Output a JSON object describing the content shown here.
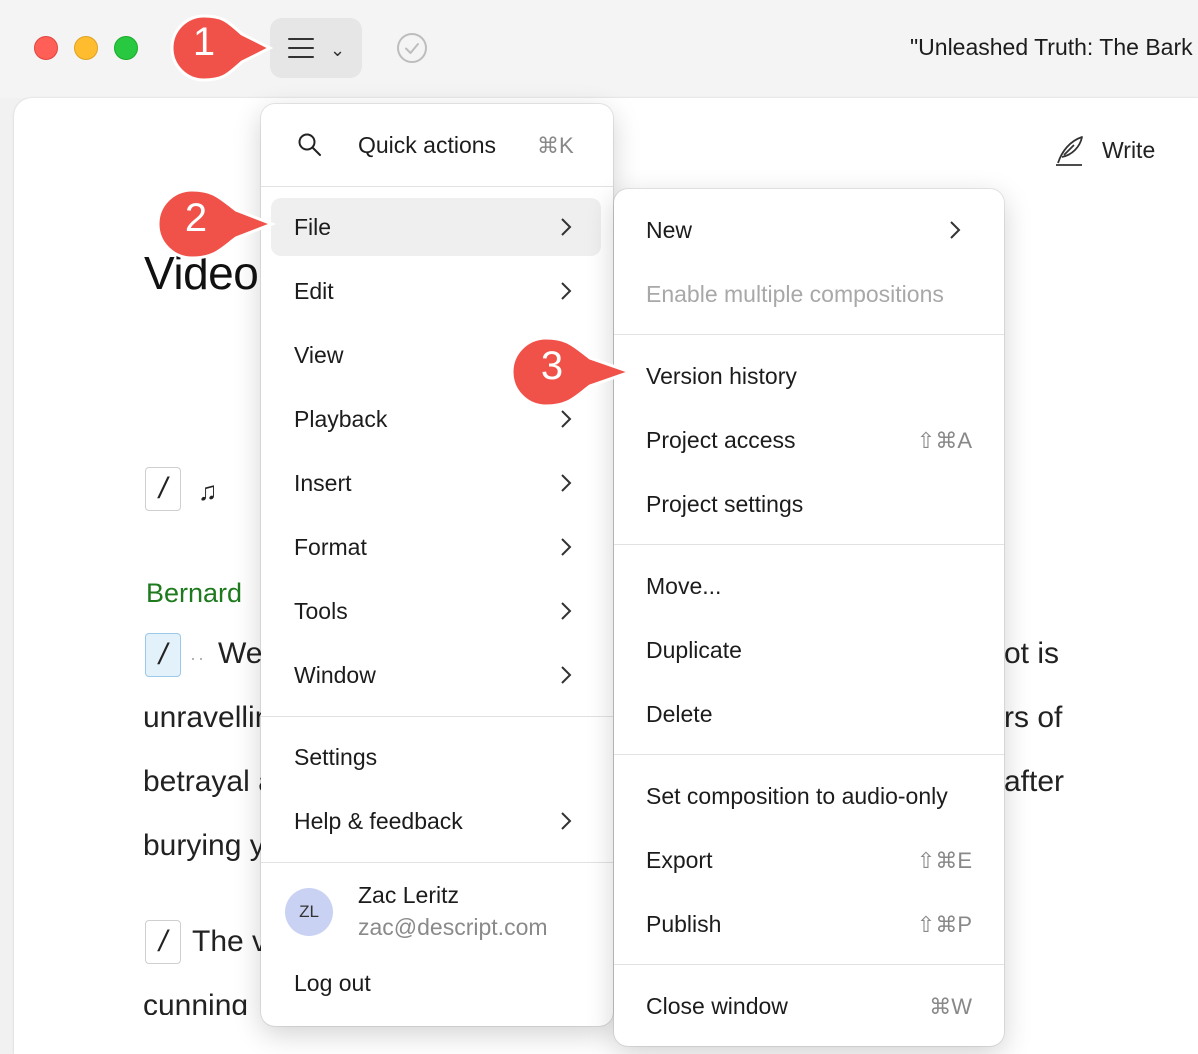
{
  "window": {
    "title": "\"Unleashed Truth: The Bark"
  },
  "toolbar": {
    "menu_icon": "hamburger-icon",
    "status_icon": "check-circle-icon",
    "write_label": "Write",
    "write_icon": "quill-icon"
  },
  "document": {
    "heading": "Video",
    "speaker": "Bernard",
    "lines": [
      "We",
      "unravellin",
      "betrayal a",
      "burying y",
      "The v",
      "cunning"
    ],
    "right_fragments": [
      "ot is",
      "rs of",
      "after"
    ],
    "slash": "/",
    "music_icon": "music-note-icon"
  },
  "main_menu": {
    "quick_actions": {
      "label": "Quick actions",
      "shortcut": "⌘K"
    },
    "items": [
      {
        "label": "File",
        "has_submenu": true,
        "selected": true
      },
      {
        "label": "Edit",
        "has_submenu": true
      },
      {
        "label": "View",
        "has_submenu": false
      },
      {
        "label": "Playback",
        "has_submenu": true
      },
      {
        "label": "Insert",
        "has_submenu": true
      },
      {
        "label": "Format",
        "has_submenu": true
      },
      {
        "label": "Tools",
        "has_submenu": true
      },
      {
        "label": "Window",
        "has_submenu": true
      }
    ],
    "settings": "Settings",
    "help": "Help & feedback",
    "user": {
      "initials": "ZL",
      "name": "Zac Leritz",
      "email": "zac@descript.com"
    },
    "logout": "Log out"
  },
  "file_submenu": {
    "new": "New",
    "enable_multiple": "Enable multiple compositions",
    "version_history": "Version history",
    "project_access": {
      "label": "Project access",
      "shortcut": "⇧⌘A"
    },
    "project_settings": "Project settings",
    "move": "Move...",
    "duplicate": "Duplicate",
    "delete": "Delete",
    "audio_only": "Set composition to audio-only",
    "export": {
      "label": "Export",
      "shortcut": "⇧⌘E"
    },
    "publish": {
      "label": "Publish",
      "shortcut": "⇧⌘P"
    },
    "close_window": {
      "label": "Close window",
      "shortcut": "⌘W"
    }
  },
  "callouts": [
    "1",
    "2",
    "3"
  ],
  "colors": {
    "callout": "#f0524a",
    "speaker": "#1d7a1d",
    "selected_bg": "#efefef"
  }
}
